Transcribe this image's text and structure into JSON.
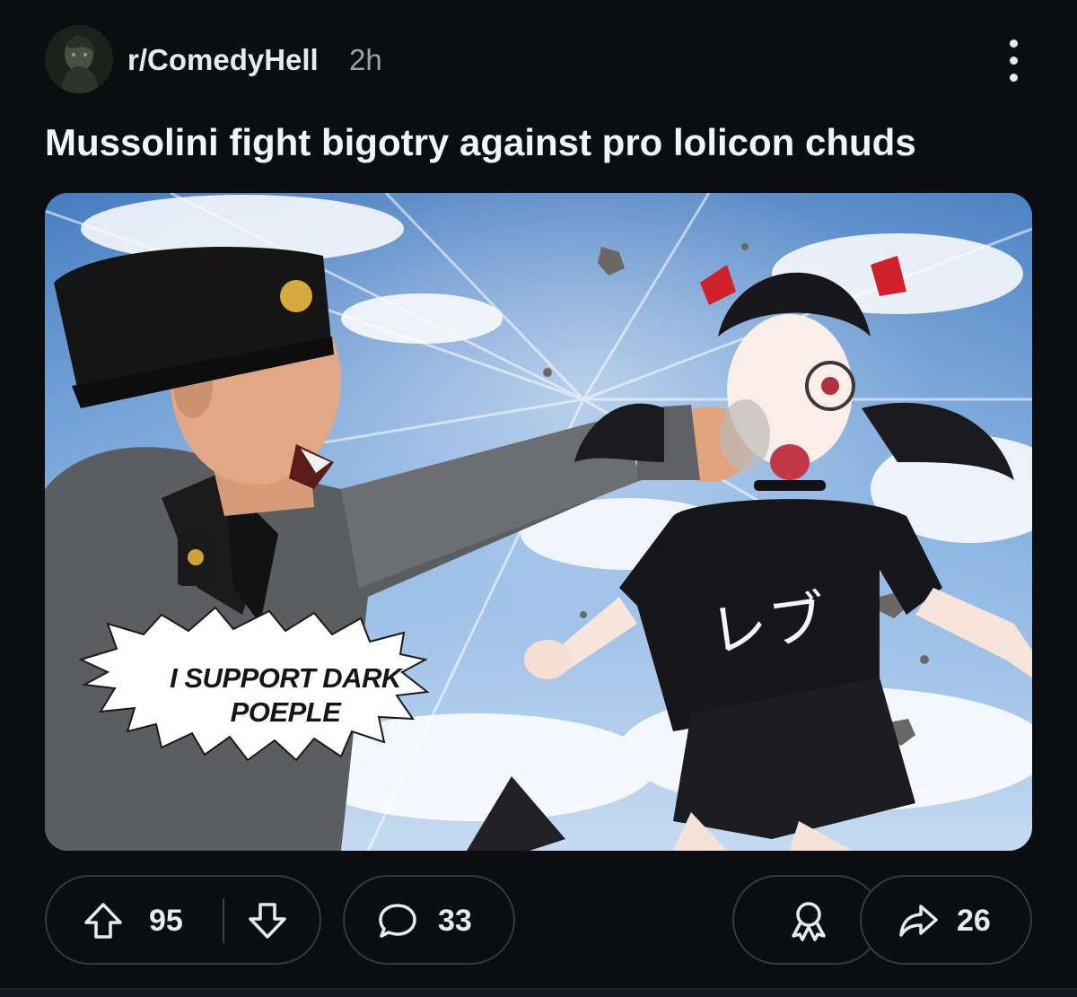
{
  "header": {
    "subreddit": "r/ComedyHell",
    "time": "2h",
    "avatar_icon": "user-avatar-icon",
    "menu_icon": "more-vertical-icon"
  },
  "post": {
    "title": "Mussolini fight bigotry against pro lolicon chuds",
    "image": {
      "speech_bubble_line1": "I SUPPORT DARK",
      "speech_bubble_line2": "POEPLE",
      "shirt_text": "レブ"
    }
  },
  "actions": {
    "upvote_icon": "arrow-up-icon",
    "downvote_icon": "arrow-down-icon",
    "score": "95",
    "comment_icon": "comment-bubble-icon",
    "comments": "33",
    "award_icon": "award-ribbon-icon",
    "share_icon": "share-arrow-icon",
    "shares": "26"
  },
  "colors": {
    "background": "#0b0d10",
    "text": "#f2f4f5",
    "muted": "#9aa2aa",
    "pill_border": "#343a40"
  }
}
